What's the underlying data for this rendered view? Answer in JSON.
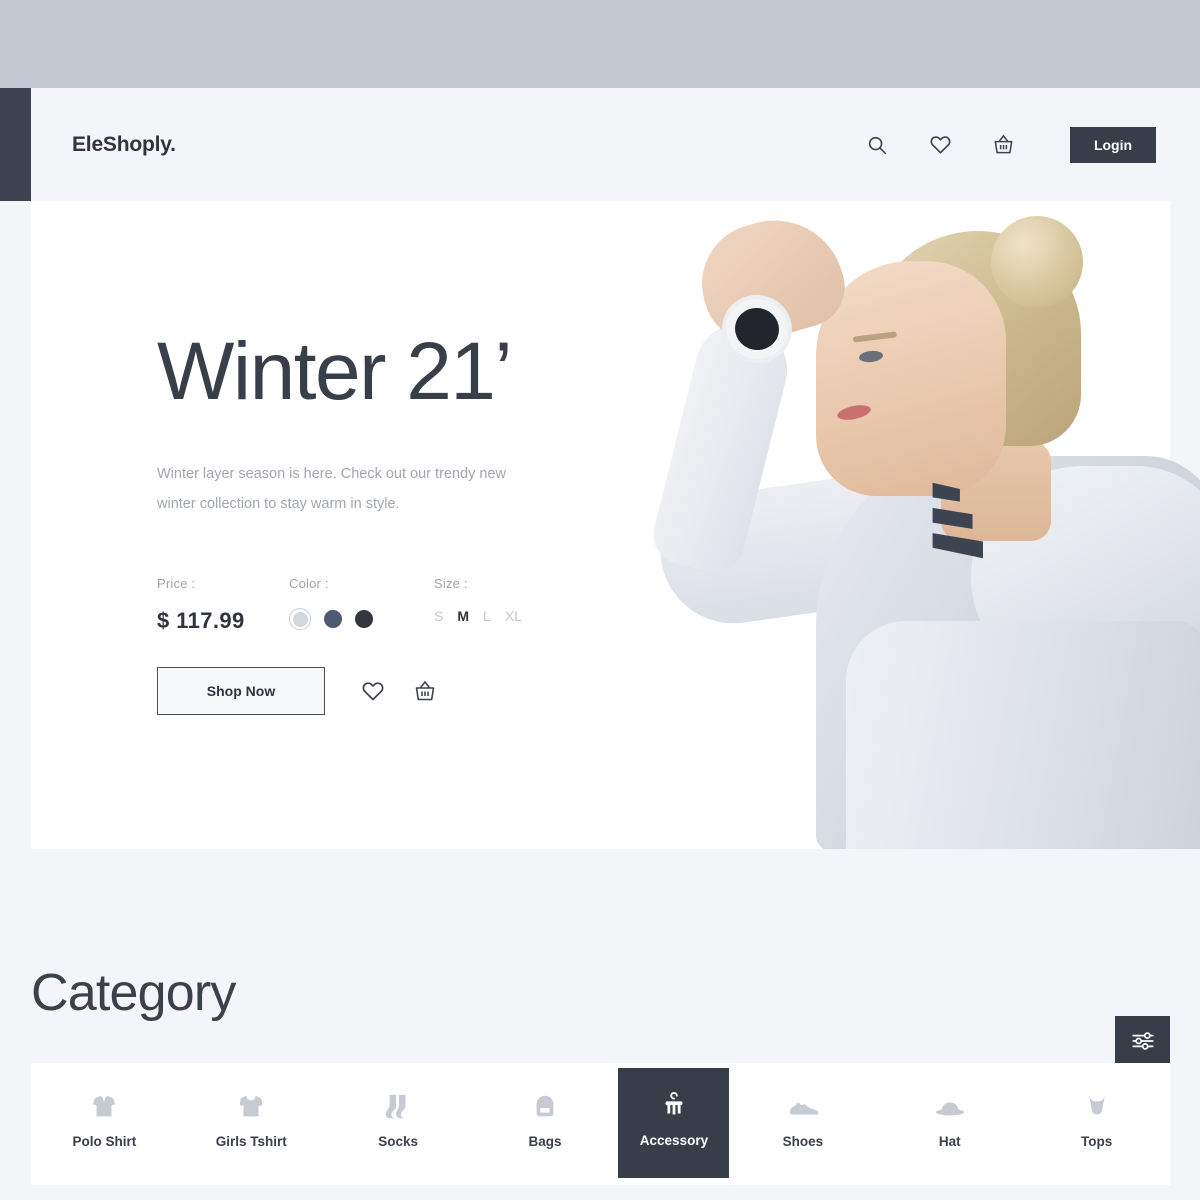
{
  "theme": {
    "page_bg": "#f4f5f8",
    "top_strip": "#c3c7d1",
    "dark": "#373d49",
    "text": "#3b414b",
    "muted": "#a2a6b0"
  },
  "header": {
    "logo": "EleShoply.",
    "icons": [
      "search-icon",
      "heart-icon",
      "basket-icon"
    ],
    "login_label": "Login"
  },
  "hero": {
    "title": "Winter 21’",
    "subtitle": "Winter layer season is here. Check out our trendy new winter collection to stay warm in style.",
    "price_label": "Price :",
    "price_value": "$ 117.99",
    "color_label": "Color :",
    "colors": [
      {
        "name": "light-gray",
        "hex": "#d3d7de",
        "selected": true
      },
      {
        "name": "slate-blue",
        "hex": "#4e5a72",
        "selected": false
      },
      {
        "name": "charcoal",
        "hex": "#33383e",
        "selected": false
      }
    ],
    "size_label": "Size :",
    "sizes": [
      {
        "label": "S",
        "selected": false
      },
      {
        "label": "M",
        "selected": true
      },
      {
        "label": "L",
        "selected": false
      },
      {
        "label": "XL",
        "selected": false
      }
    ],
    "shop_label": "Shop Now",
    "wishlist_icon": "heart-icon",
    "cart_icon": "basket-icon",
    "image_alt": "woman-in-gray-adidas-hoodie"
  },
  "category": {
    "title": "Category",
    "filter_icon": "sliders-icon",
    "items": [
      {
        "label": "Polo Shirt",
        "icon": "polo-shirt-icon",
        "active": false
      },
      {
        "label": "Girls Tshirt",
        "icon": "tshirt-icon",
        "active": false
      },
      {
        "label": "Socks",
        "icon": "socks-icon",
        "active": false
      },
      {
        "label": "Bags",
        "icon": "bag-icon",
        "active": false
      },
      {
        "label": "Accessory",
        "icon": "hanger-icon",
        "active": true
      },
      {
        "label": "Shoes",
        "icon": "shoe-icon",
        "active": false
      },
      {
        "label": "Hat",
        "icon": "hat-icon",
        "active": false
      },
      {
        "label": "Tops",
        "icon": "top-icon",
        "active": false
      }
    ]
  }
}
